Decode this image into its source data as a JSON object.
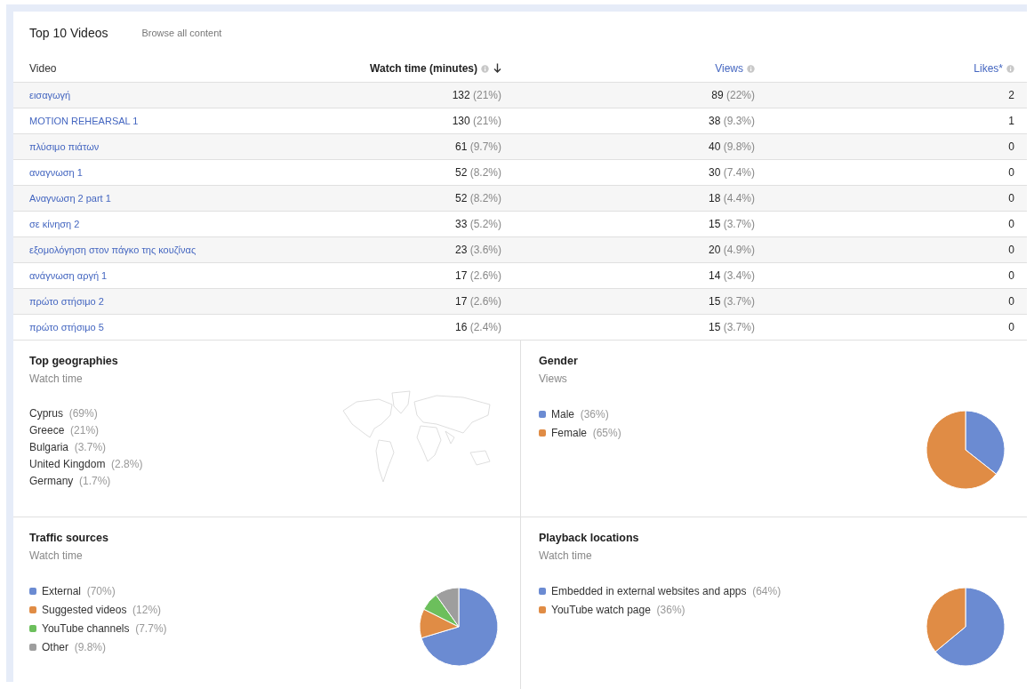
{
  "top_videos": {
    "title": "Top 10 Videos",
    "browse_link": "Browse all content",
    "columns": [
      {
        "label": "Video",
        "kind": "plain"
      },
      {
        "label": "Watch time (minutes)",
        "kind": "sorted"
      },
      {
        "label": "Views",
        "kind": "link"
      },
      {
        "label": "Likes*",
        "kind": "link"
      }
    ],
    "rows": [
      {
        "video": "εισαγωγή",
        "watch_time": "132",
        "watch_share": "(21%)",
        "views": "89",
        "views_share": "(22%)",
        "likes": "2"
      },
      {
        "video": "MOTION REHEARSAL 1",
        "watch_time": "130",
        "watch_share": "(21%)",
        "views": "38",
        "views_share": "(9.3%)",
        "likes": "1"
      },
      {
        "video": "πλύσιμο πιάτων",
        "watch_time": "61",
        "watch_share": "(9.7%)",
        "views": "40",
        "views_share": "(9.8%)",
        "likes": "0"
      },
      {
        "video": "αναγνωση 1",
        "watch_time": "52",
        "watch_share": "(8.2%)",
        "views": "30",
        "views_share": "(7.4%)",
        "likes": "0"
      },
      {
        "video": "Αναγνωση 2 part 1",
        "watch_time": "52",
        "watch_share": "(8.2%)",
        "views": "18",
        "views_share": "(4.4%)",
        "likes": "0"
      },
      {
        "video": "σε κίνηση 2",
        "watch_time": "33",
        "watch_share": "(5.2%)",
        "views": "15",
        "views_share": "(3.7%)",
        "likes": "0"
      },
      {
        "video": "εξομολόγηση στον πάγκο της κουζίνας",
        "watch_time": "23",
        "watch_share": "(3.6%)",
        "views": "20",
        "views_share": "(4.9%)",
        "likes": "0"
      },
      {
        "video": "ανάγνωση αργή 1",
        "watch_time": "17",
        "watch_share": "(2.6%)",
        "views": "14",
        "views_share": "(3.4%)",
        "likes": "0"
      },
      {
        "video": "πρώτο στήσιμο 2",
        "watch_time": "17",
        "watch_share": "(2.6%)",
        "views": "15",
        "views_share": "(3.7%)",
        "likes": "0"
      },
      {
        "video": "πρώτο στήσιμο 5",
        "watch_time": "16",
        "watch_share": "(2.4%)",
        "views": "15",
        "views_share": "(3.7%)",
        "likes": "0"
      }
    ]
  },
  "panels": [
    {
      "kind": "map",
      "title": "Top geographies",
      "subtitle": "Watch time",
      "legend": [
        {
          "label": "Cyprus",
          "share": "(69%)"
        },
        {
          "label": "Greece",
          "share": "(21%)"
        },
        {
          "label": "Bulgaria",
          "share": "(3.7%)"
        },
        {
          "label": "United Kingdom",
          "share": "(2.8%)"
        },
        {
          "label": "Germany",
          "share": "(1.7%)"
        }
      ]
    },
    {
      "kind": "pie",
      "title": "Gender",
      "subtitle": "Views",
      "legend": [
        {
          "label": "Male",
          "share": "(36%)",
          "color": "#6b8bd2"
        },
        {
          "label": "Female",
          "share": "(65%)",
          "color": "#e08c45"
        }
      ],
      "chart_data": {
        "type": "pie",
        "values": [
          36,
          65
        ]
      }
    },
    {
      "kind": "pie",
      "title": "Traffic sources",
      "subtitle": "Watch time",
      "legend": [
        {
          "label": "External",
          "share": "(70%)",
          "color": "#6b8bd2"
        },
        {
          "label": "Suggested videos",
          "share": "(12%)",
          "color": "#e08c45"
        },
        {
          "label": "YouTube channels",
          "share": "(7.7%)",
          "color": "#6cbf5c"
        },
        {
          "label": "Other",
          "share": "(9.8%)",
          "color": "#9e9e9e"
        }
      ],
      "chart_data": {
        "type": "pie",
        "values": [
          70,
          12,
          7.7,
          9.8
        ]
      }
    },
    {
      "kind": "pie",
      "title": "Playback locations",
      "subtitle": "Watch time",
      "legend": [
        {
          "label": "Embedded in external websites and apps",
          "share": "(64%)",
          "color": "#6b8bd2"
        },
        {
          "label": "YouTube watch page",
          "share": "(36%)",
          "color": "#e08c45"
        }
      ],
      "chart_data": {
        "type": "pie",
        "values": [
          64,
          36
        ]
      }
    }
  ]
}
